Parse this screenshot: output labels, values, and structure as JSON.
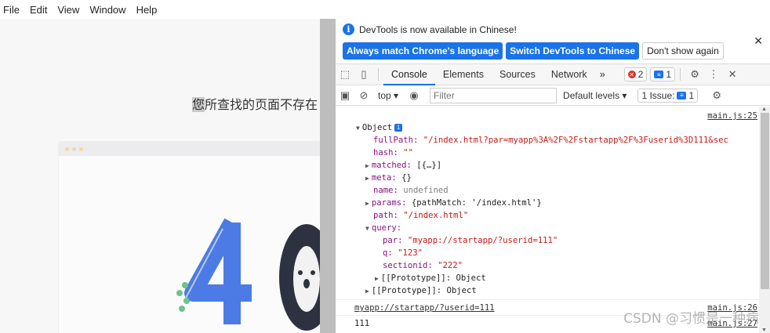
{
  "menu": [
    "File",
    "Edit",
    "View",
    "Window",
    "Help"
  ],
  "page": {
    "title_prefix": "您",
    "title_rest": "所查找的页面不存在"
  },
  "devtools": {
    "info": {
      "message": "DevTools is now available in Chinese!",
      "btn_match": "Always match Chrome's language",
      "btn_switch": "Switch DevTools to Chinese",
      "btn_dont": "Don't show again"
    },
    "tabs": [
      "Console",
      "Elements",
      "Sources",
      "Network"
    ],
    "more": "»",
    "errors": "2",
    "messages": "1",
    "context": "top",
    "filter_placeholder": "Filter",
    "levels": "Default levels",
    "issues_label": "1 Issue:",
    "issues_count": "1"
  },
  "console": {
    "src1": "main.js:25",
    "object_label": "Object",
    "fullPath_key": "fullPath:",
    "fullPath_val": "\"/index.html?par=myapp%3A%2F%2Fstartapp%2F%3Fuserid%3D111&sec",
    "hash_key": "hash:",
    "hash_val": "\"\"",
    "matched_key": "matched:",
    "matched_val": "[{…}]",
    "meta_key": "meta:",
    "meta_val": "{}",
    "name_key": "name:",
    "name_val": "undefined",
    "params_key": "params:",
    "params_val": "{pathMatch: '/index.html'}",
    "path_key": "path:",
    "path_val": "\"/index.html\"",
    "query_key": "query:",
    "par_key": "par:",
    "par_val": "\"myapp://startapp/?userid=111\"",
    "q_key": "q:",
    "q_val": "\"123\"",
    "sectionid_key": "sectionid:",
    "sectionid_val": "\"222\"",
    "proto_inner": "[[Prototype]]:",
    "proto_inner_val": "Object",
    "proto_outer": "[[Prototype]]:",
    "proto_outer_val": "Object",
    "log2": "myapp://startapp/?userid=111",
    "src2": "main.js:26",
    "log3": "111",
    "src3": "main.js:27"
  },
  "watermark": "CSDN @习惯是一种病",
  "colors": {
    "accent": "#1a73e8",
    "key": "#881280",
    "string": "#c41a16"
  }
}
